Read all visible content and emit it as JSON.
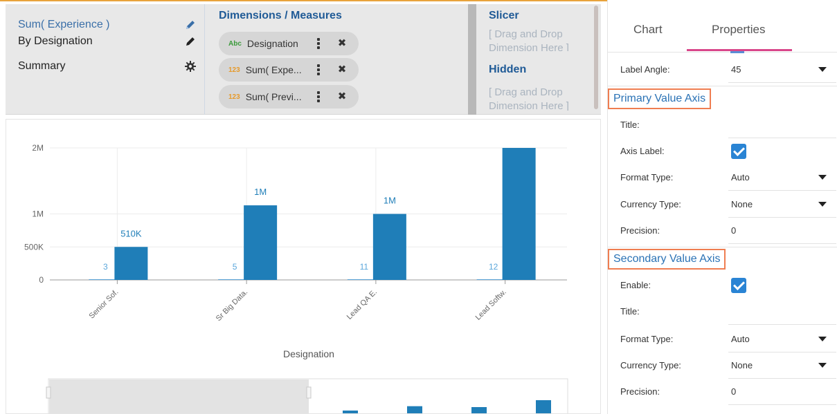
{
  "config": {
    "left_items": [
      {
        "label": "Sum( Experience )",
        "icon": "pencil-icon"
      },
      {
        "label": "By Designation",
        "icon": "pencil-icon"
      },
      {
        "label": "Summary",
        "icon": "gear-icon"
      }
    ],
    "dimensions_title": "Dimensions / Measures",
    "pills": [
      {
        "tag": "Abc",
        "label": "Designation"
      },
      {
        "tag": "123",
        "label": "Sum( Expe..."
      },
      {
        "tag": "123",
        "label": "Sum( Previ..."
      }
    ],
    "slicer_title": "Slicer",
    "slicer_drop": "[ Drag and Drop Dimension Here ]",
    "hidden_title": "Hidden",
    "hidden_drop": "[ Drag and Drop Dimension Here ]"
  },
  "colors": {
    "bar": "#1f7eb8",
    "small_label": "#5aa6db",
    "accent": "#2a72b5",
    "highlight": "#ef7d50",
    "tab_underline": "#d9468a"
  },
  "chart_data": {
    "type": "bar",
    "categories": [
      "Senior Sof.",
      "Sr Big Data.",
      "Lead QA E.",
      "Lead Softw."
    ],
    "series": [
      {
        "values": [
          3,
          5,
          11,
          12
        ],
        "labels": [
          "3",
          "5",
          "11",
          "12"
        ]
      },
      {
        "values": [
          500000,
          1130000,
          1000000,
          2000000
        ],
        "labels": [
          "510K",
          "1M",
          "1M",
          ""
        ]
      }
    ],
    "yticks": [
      "0",
      "500K",
      "1M",
      "2M"
    ],
    "ylim": [
      0,
      2000000
    ],
    "xlabel": "Designation",
    "label_angle": 45,
    "grid": true
  },
  "props": {
    "tabs": [
      "Chart",
      "Properties"
    ],
    "label_angle": {
      "label": "Label Angle:",
      "value": "45"
    },
    "primary_title": "Primary Value Axis",
    "primary": [
      {
        "label": "Title:",
        "value": ""
      },
      {
        "label": "Axis Label:",
        "checked": true
      },
      {
        "label": "Format Type:",
        "value": "Auto",
        "dropdown": true
      },
      {
        "label": "Currency Type:",
        "value": "None",
        "dropdown": true
      },
      {
        "label": "Precision:",
        "value": "0"
      }
    ],
    "secondary_title": "Secondary Value Axis",
    "secondary": [
      {
        "label": "Enable:",
        "checked": true
      },
      {
        "label": "Title:",
        "value": ""
      },
      {
        "label": "Format Type:",
        "value": "Auto",
        "dropdown": true
      },
      {
        "label": "Currency Type:",
        "value": "None",
        "dropdown": true
      },
      {
        "label": "Precision:",
        "value": "0"
      }
    ]
  }
}
